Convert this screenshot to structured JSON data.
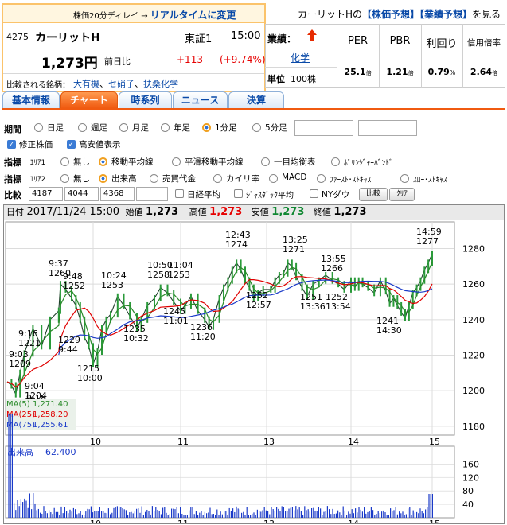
{
  "header": {
    "delay_note": "株価20分ディレイ → ",
    "realtime_link": "リアルタイムに変更",
    "forecast_prefix": "カーリットHの",
    "forecast_link1": "【株価予想】",
    "forecast_link2": "【業績予想】",
    "forecast_suffix": "を見る"
  },
  "stock": {
    "code": "4275",
    "name": "カーリットH",
    "market": "東証1",
    "time": "15:00",
    "price": "1,273円",
    "prev_label": "前日比",
    "change": "+113",
    "change_pct": "(+9.74%)",
    "compare_label": "比較される銘柄：",
    "compare": [
      "大有機",
      "セ硝子",
      "扶桑化学"
    ]
  },
  "business": {
    "label": "業績：",
    "sector": "化学",
    "unit_label": "単位",
    "unit_value": "100株"
  },
  "metrics": [
    {
      "label": "PER",
      "value": "25.1",
      "unit": "倍"
    },
    {
      "label": "PBR",
      "value": "1.21",
      "unit": "倍"
    },
    {
      "label": "利回り",
      "value": "0.79",
      "unit": "%"
    },
    {
      "label": "信用倍率",
      "value": "2.64",
      "unit": "倍"
    }
  ],
  "tabs": [
    "基本情報",
    "チャート",
    "時系列",
    "ニュース",
    "決算"
  ],
  "active_tab": 1,
  "controls": {
    "period_label": "期間",
    "period_options": [
      "日足",
      "週足",
      "月足",
      "年足",
      "1分足",
      "5分足"
    ],
    "period_selected": 4,
    "check1": "修正株価",
    "check2": "高安値表示",
    "ind1_label": "指標",
    "area1": "ｴﾘｱ1",
    "ind1_options": [
      "無し",
      "移動平均線",
      "平滑移動平均線",
      "一目均衡表",
      "ﾎﾞﾘﾝｼﾞｬｰﾊﾞﾝﾄﾞ"
    ],
    "ind1_selected": 1,
    "ind2_label": "指標",
    "area2": "ｴﾘｱ2",
    "ind2_options": [
      "無し",
      "出来高",
      "売買代金",
      "カイリ率",
      "MACD",
      "ﾌｧｰｽﾄ･ｽﾄｷｬｽ",
      "ｽﾛｰ･ｽﾄｷｬｽ"
    ],
    "ind2_selected": 1,
    "compare_label": "比較",
    "compare_codes": [
      "4187",
      "4044",
      "4368",
      ""
    ],
    "compare_options": [
      "日経平均",
      "ｼﾞｬｽﾀﾞｯｸ平均",
      "NYダウ"
    ],
    "compare_btn": "比較",
    "clear_btn": "ｸﾘｱ"
  },
  "chart_info": {
    "date_label": "日付",
    "date": "2017/11/24 15:00",
    "open_label": "始値",
    "open": "1,273",
    "high_label": "高値",
    "high": "1,273",
    "low_label": "安値",
    "low": "1,273",
    "close_label": "終値",
    "close": "1,273"
  },
  "chart_data": {
    "type": "line",
    "x_tick_labels": [
      "10",
      "11",
      "13",
      "14",
      "15"
    ],
    "price_ylim": [
      1175,
      1295
    ],
    "price_ticks": [
      1180,
      1200,
      1220,
      1240,
      1260,
      1280
    ],
    "price_series": [
      [
        9.0,
        1205
      ],
      [
        9.05,
        1203
      ],
      [
        9.1,
        1198
      ],
      [
        9.15,
        1210
      ],
      [
        9.2,
        1221
      ],
      [
        9.3,
        1235
      ],
      [
        9.4,
        1225
      ],
      [
        9.5,
        1240
      ],
      [
        9.6,
        1245
      ],
      [
        9.62,
        1260
      ],
      [
        9.68,
        1257
      ],
      [
        9.75,
        1252
      ],
      [
        9.8,
        1248
      ],
      [
        9.85,
        1240
      ],
      [
        9.9,
        1230
      ],
      [
        9.95,
        1225
      ],
      [
        10.0,
        1215
      ],
      [
        10.05,
        1222
      ],
      [
        10.1,
        1235
      ],
      [
        10.15,
        1240
      ],
      [
        10.2,
        1243
      ],
      [
        10.28,
        1253
      ],
      [
        10.35,
        1248
      ],
      [
        10.42,
        1242
      ],
      [
        10.5,
        1235
      ],
      [
        10.55,
        1240
      ],
      [
        10.62,
        1248
      ],
      [
        10.7,
        1252
      ],
      [
        10.77,
        1258
      ],
      [
        10.85,
        1255
      ],
      [
        10.92,
        1250
      ],
      [
        11.0,
        1245
      ],
      [
        11.05,
        1248
      ],
      [
        11.12,
        1253
      ],
      [
        11.2,
        1245
      ],
      [
        11.28,
        1240
      ],
      [
        11.33,
        1236
      ],
      [
        11.38,
        1240
      ],
      [
        11.45,
        1252
      ],
      [
        11.5,
        1258
      ],
      [
        11.55,
        1262
      ],
      [
        11.6,
        1268
      ],
      [
        11.65,
        1272
      ],
      [
        11.7,
        1268
      ],
      [
        11.75,
        1262
      ],
      [
        11.8,
        1258
      ],
      [
        11.85,
        1252
      ],
      [
        11.9,
        1255
      ],
      [
        11.96,
        1257
      ],
      [
        12.05,
        1257
      ],
      [
        12.1,
        1262
      ],
      [
        12.15,
        1265
      ],
      [
        12.2,
        1266
      ],
      [
        12.25,
        1272
      ],
      [
        12.3,
        1270
      ],
      [
        12.35,
        1264
      ],
      [
        12.42,
        1258
      ],
      [
        12.48,
        1253
      ],
      [
        12.55,
        1260
      ],
      [
        12.62,
        1262
      ],
      [
        12.7,
        1265
      ],
      [
        12.78,
        1262
      ],
      [
        12.85,
        1260
      ],
      [
        12.92,
        1257
      ],
      [
        13.0,
        1262
      ],
      [
        13.05,
        1258
      ],
      [
        13.1,
        1262
      ],
      [
        13.15,
        1260
      ],
      [
        13.22,
        1258
      ],
      [
        13.3,
        1255
      ],
      [
        13.38,
        1262
      ],
      [
        13.45,
        1256
      ],
      [
        13.5,
        1249
      ],
      [
        13.55,
        1252
      ],
      [
        13.6,
        1248
      ],
      [
        13.65,
        1244
      ],
      [
        13.7,
        1241
      ],
      [
        13.75,
        1248
      ],
      [
        13.8,
        1255
      ],
      [
        13.85,
        1258
      ],
      [
        13.9,
        1262
      ],
      [
        13.95,
        1268
      ],
      [
        14.0,
        1272
      ],
      [
        14.05,
        1277
      ]
    ],
    "price_series_notes": "approximate intraday 1-minute price path",
    "ma_series": [
      {
        "name": "MA(5)",
        "value": "1,271.40",
        "color": "#2a8a2a"
      },
      {
        "name": "MA(25)",
        "value": "1,258.20",
        "color": "#e00000"
      },
      {
        "name": "MA(75)",
        "value": "1,255.61",
        "color": "#1a3ac8"
      }
    ],
    "price_labels": [
      {
        "t": "9:03",
        "v": "1209"
      },
      {
        "t": "9:04",
        "v": "1204"
      },
      {
        "t": "9:18",
        "v": ""
      },
      {
        "t": "9:16",
        "v": "1221"
      },
      {
        "t": "9:37",
        "v": "1260"
      },
      {
        "t": "9:48",
        "v": "1252"
      },
      {
        "t": "1229",
        "v": "9:44"
      },
      {
        "t": "1215",
        "v": "10:00"
      },
      {
        "t": "10:24",
        "v": "1253"
      },
      {
        "t": "1235",
        "v": "10:32"
      },
      {
        "t": "10:50",
        "v": "1258"
      },
      {
        "t": "11:04",
        "v": "1253"
      },
      {
        "t": "1245",
        "v": "11:01"
      },
      {
        "t": "1236",
        "v": "11:20"
      },
      {
        "t": "12:43",
        "v": "1274"
      },
      {
        "t": "1252",
        "v": "12:57"
      },
      {
        "t": "13:25",
        "v": "1271"
      },
      {
        "t": "1251",
        "v": "13:36"
      },
      {
        "t": "13:55",
        "v": "1266"
      },
      {
        "t": "1252",
        "v": "13:54"
      },
      {
        "t": "1241",
        "v": "14:30"
      },
      {
        "t": "14:59",
        "v": "1277"
      }
    ],
    "volume_label": "出来高",
    "volume_value": "62.400",
    "volume_ticks": [
      40,
      80,
      120,
      160
    ]
  }
}
